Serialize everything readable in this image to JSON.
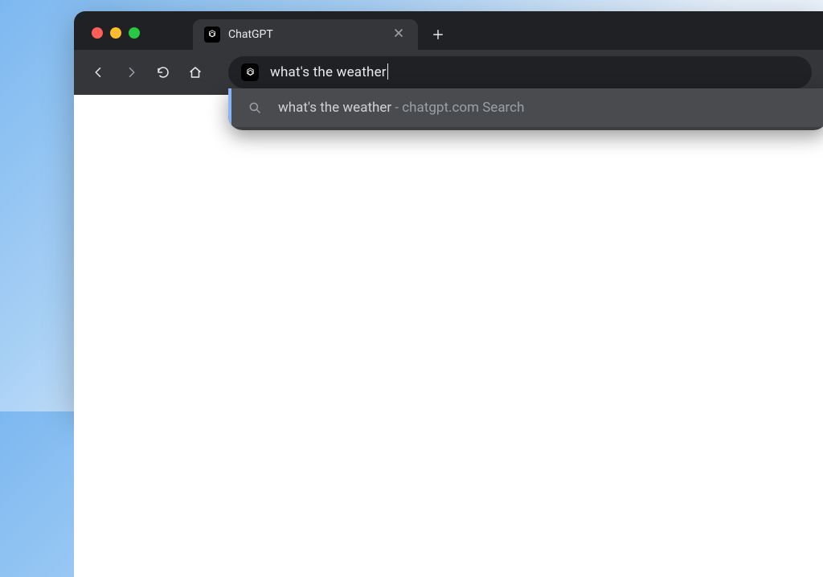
{
  "window": {
    "controls": {
      "close": "close",
      "min": "minimize",
      "max": "maximize"
    }
  },
  "tab": {
    "title": "ChatGPT",
    "icon": "openai-icon"
  },
  "toolbar": {
    "back": {
      "name": "back"
    },
    "forward": {
      "name": "forward"
    },
    "reload": {
      "name": "reload"
    },
    "home": {
      "name": "home"
    }
  },
  "omnibox": {
    "site_icon": "openai-icon",
    "text": "what's the weather"
  },
  "suggestions": [
    {
      "query": "what's the weather",
      "separator": " - ",
      "source": "chatgpt.com Search",
      "icon": "search"
    }
  ]
}
